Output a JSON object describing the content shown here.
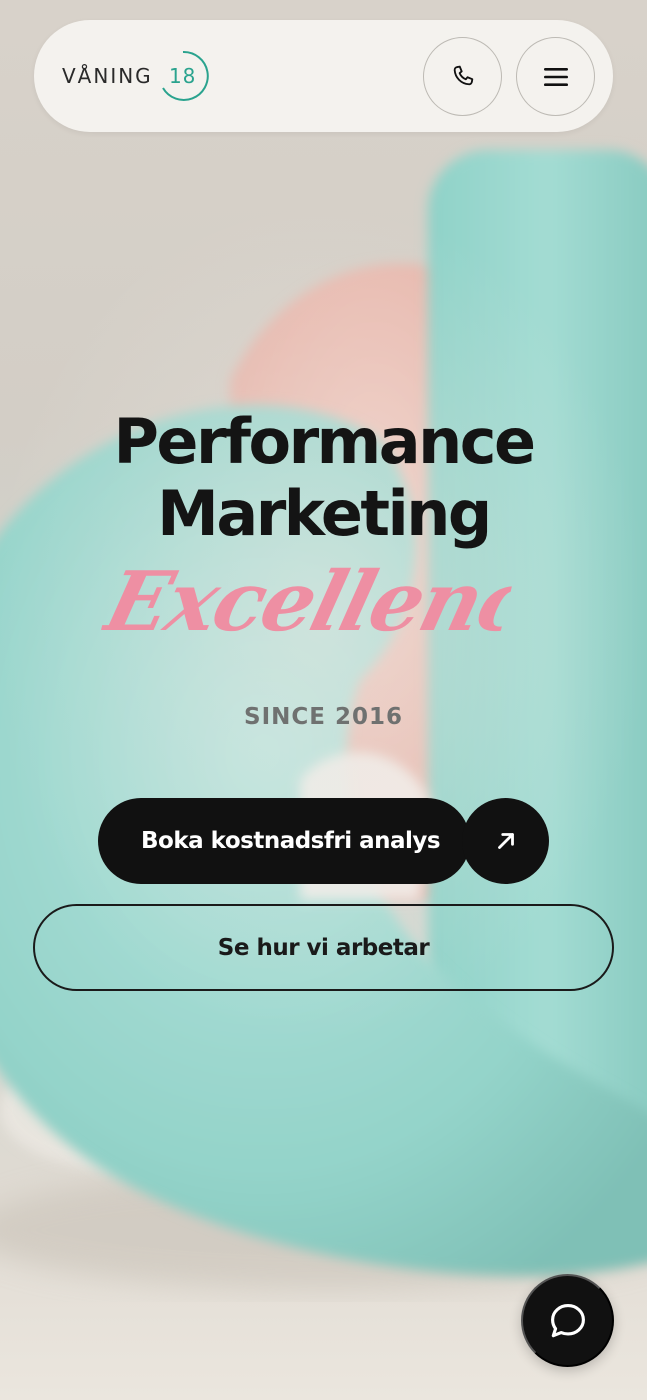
{
  "header": {
    "logo_text": "VÅNING",
    "logo_number": "18",
    "phone_icon": "phone-icon",
    "menu_icon": "hamburger-menu-icon"
  },
  "hero": {
    "title_line1": "Performance",
    "title_line2": "Marketing",
    "script_word": "Excellenc",
    "since": "SINCE 2016"
  },
  "cta": {
    "primary_label": "Boka kostnadsfri analys",
    "primary_icon": "arrow-up-right-icon",
    "secondary_label": "Se hur vi arbetar"
  },
  "chat": {
    "icon": "chat-bubble-icon"
  },
  "colors": {
    "accent_teal": "#2aa38e",
    "script_pink": "#ee8fa3",
    "dark": "#111111",
    "nav_bg": "#f4f2ee"
  }
}
